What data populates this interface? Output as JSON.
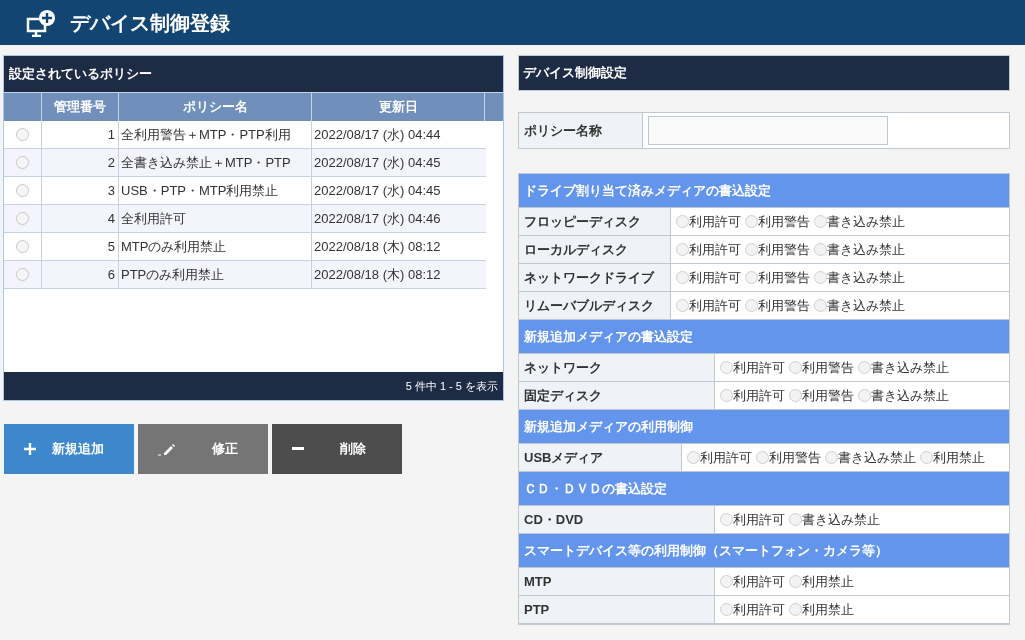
{
  "header": {
    "title": "デバイス制御登録"
  },
  "policies": {
    "title": "設定されているポリシー",
    "columns": [
      "管理番号",
      "ポリシー名",
      "更新日"
    ],
    "rows": [
      {
        "selected": false,
        "number": "1",
        "name": "全利用警告＋MTP・PTP利用",
        "updated": "2022/08/17 (水) 04:44"
      },
      {
        "selected": false,
        "number": "2",
        "name": "全書き込み禁止＋MTP・PTP",
        "updated": "2022/08/17 (水) 04:45"
      },
      {
        "selected": false,
        "number": "3",
        "name": "USB・PTP・MTP利用禁止",
        "updated": "2022/08/17 (水) 04:45"
      },
      {
        "selected": false,
        "number": "4",
        "name": "全利用許可",
        "updated": "2022/08/17 (水) 04:46"
      },
      {
        "selected": false,
        "number": "5",
        "name": "MTPのみ利用禁止",
        "updated": "2022/08/18 (木) 08:12"
      },
      {
        "selected": false,
        "number": "6",
        "name": "PTPのみ利用禁止",
        "updated": "2022/08/18 (木) 08:12"
      }
    ],
    "footer": "5 件中 1 - 5 を表示"
  },
  "buttons": [
    {
      "kind": "add",
      "label": "新規追加"
    },
    {
      "kind": "edit",
      "label": "修正"
    },
    {
      "kind": "delete",
      "label": "削除"
    }
  ],
  "settings": {
    "title": "デバイス制御設定",
    "policy_name": {
      "label": "ポリシー名称"
    },
    "sections": [
      {
        "title": "ドライブ割り当て済みメディアの書込設定",
        "rows": [
          {
            "label": "フロッピーディスク",
            "options": [
              {
                "label": "利用許可",
                "selected": false
              },
              {
                "label": "利用警告",
                "selected": false
              },
              {
                "label": "書き込み禁止",
                "selected": false
              }
            ]
          },
          {
            "label": "ローカルディスク",
            "options": [
              {
                "label": "利用許可",
                "selected": false
              },
              {
                "label": "利用警告",
                "selected": false
              },
              {
                "label": "書き込み禁止",
                "selected": false
              }
            ]
          },
          {
            "label": "ネットワークドライブ",
            "options": [
              {
                "label": "利用許可",
                "selected": false
              },
              {
                "label": "利用警告",
                "selected": false
              },
              {
                "label": "書き込み禁止",
                "selected": false
              }
            ]
          },
          {
            "label": "リムーバブルディスク",
            "options": [
              {
                "label": "利用許可",
                "selected": false
              },
              {
                "label": "利用警告",
                "selected": false
              },
              {
                "label": "書き込み禁止",
                "selected": false
              }
            ]
          }
        ]
      },
      {
        "title": "新規追加メディアの書込設定",
        "rows": [
          {
            "label": "ネットワーク",
            "options": [
              {
                "label": "利用許可",
                "selected": false
              },
              {
                "label": "利用警告",
                "selected": false
              },
              {
                "label": "書き込み禁止",
                "selected": false
              }
            ]
          },
          {
            "label": "固定ディスク",
            "options": [
              {
                "label": "利用許可",
                "selected": false
              },
              {
                "label": "利用警告",
                "selected": false
              },
              {
                "label": "書き込み禁止",
                "selected": false
              }
            ]
          }
        ]
      },
      {
        "title": "新規追加メディアの利用制御",
        "rows": [
          {
            "label": "USBメディア",
            "options": [
              {
                "label": "利用許可",
                "selected": false
              },
              {
                "label": "利用警告",
                "selected": false
              },
              {
                "label": "書き込み禁止",
                "selected": false
              },
              {
                "label": "利用禁止",
                "selected": false
              }
            ]
          }
        ]
      },
      {
        "title": "ＣＤ・ＤＶＤの書込設定",
        "rows": [
          {
            "label": "CD・DVD",
            "options": [
              {
                "label": "利用許可",
                "selected": false
              },
              {
                "label": "書き込み禁止",
                "selected": false
              }
            ]
          }
        ]
      },
      {
        "title": "スマートデバイス等の利用制御（スマートフォン・カメラ等）",
        "rows": [
          {
            "label": "MTP",
            "options": [
              {
                "label": "利用許可",
                "selected": false
              },
              {
                "label": "利用禁止",
                "selected": false
              }
            ]
          },
          {
            "label": "PTP",
            "options": [
              {
                "label": "利用許可",
                "selected": false
              },
              {
                "label": "利用禁止",
                "selected": false
              }
            ]
          }
        ]
      }
    ]
  }
}
